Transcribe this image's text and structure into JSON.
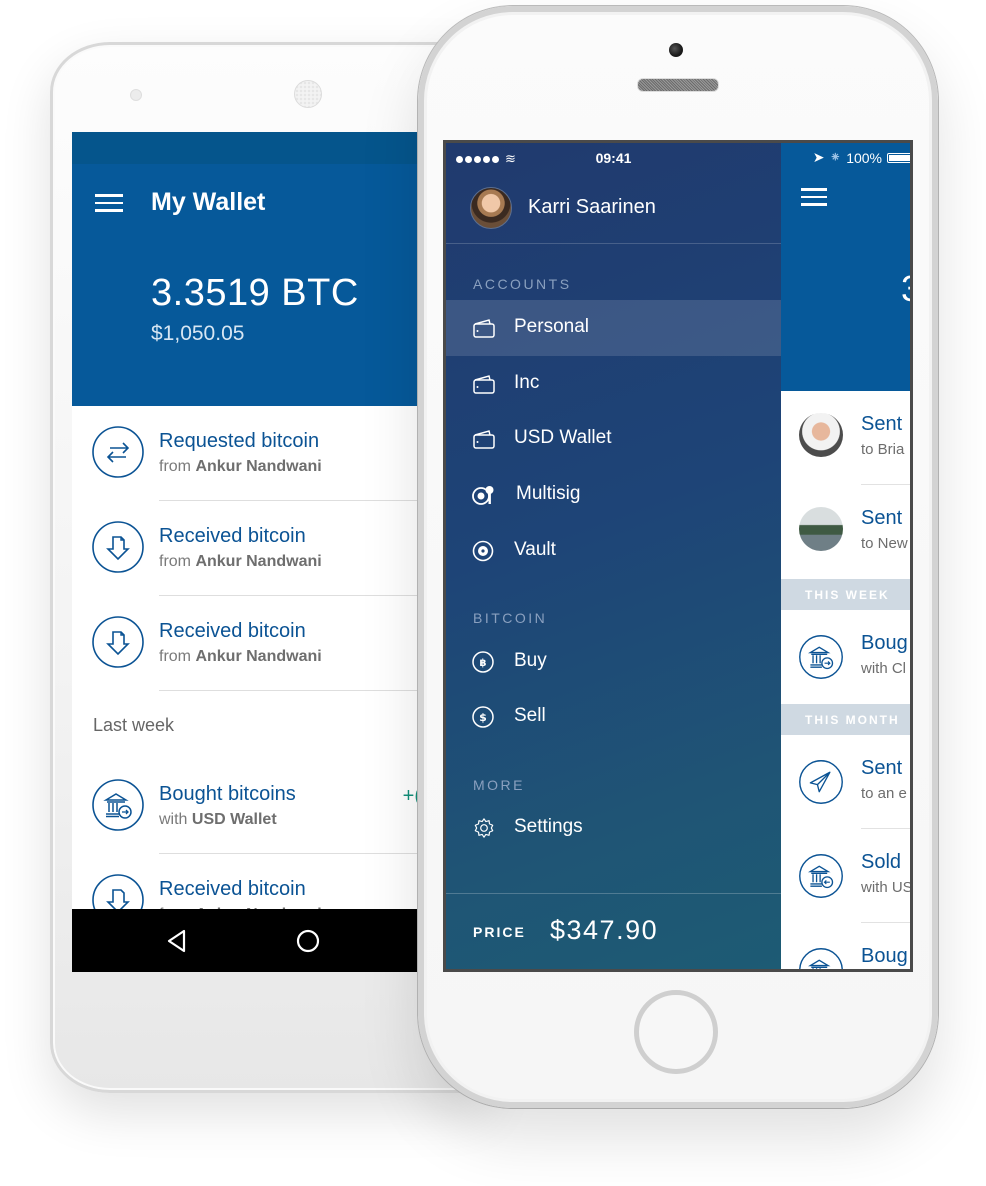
{
  "android": {
    "title": "My Wallet",
    "balance_btc": "3.3519 BTC",
    "balance_usd": "$1,050.05",
    "transactions": [
      {
        "title": "Requested bitcoin",
        "prefix": "from",
        "party": "Ankur Nandwani",
        "icon": "request-arrows-icon"
      },
      {
        "title": "Received bitcoin",
        "prefix": "from",
        "party": "Ankur Nandwani",
        "icon": "receive-download-icon"
      },
      {
        "title": "Received bitcoin",
        "prefix": "from",
        "party": "Ankur Nandwani",
        "icon": "receive-download-icon"
      }
    ],
    "section_last_week": "Last week",
    "last_week_transactions": [
      {
        "title": "Bought bitcoins",
        "prefix": "with",
        "party": "USD Wallet",
        "amount": "+(",
        "icon": "bank-buy-icon"
      },
      {
        "title": "Received bitcoin",
        "prefix": "from",
        "party": "Ankur Nandwani",
        "icon": "receive-download-icon"
      }
    ],
    "colors": {
      "header": "#06599a",
      "accent_text": "#0b5394",
      "positive": "#12907a"
    }
  },
  "iphone": {
    "status": {
      "time": "09:41",
      "battery": "100%"
    },
    "drawer": {
      "user_name": "Karri Saarinen",
      "accounts_heading": "ACCOUNTS",
      "accounts": [
        {
          "label": "Personal",
          "icon": "wallet-icon",
          "active": true
        },
        {
          "label": "Inc",
          "icon": "wallet-icon"
        },
        {
          "label": "USD Wallet",
          "icon": "wallet-icon"
        },
        {
          "label": "Multisig",
          "icon": "multisig-key-icon"
        },
        {
          "label": "Vault",
          "icon": "vault-icon"
        }
      ],
      "bitcoin_heading": "BITCOIN",
      "bitcoin_items": [
        {
          "label": "Buy",
          "icon": "bitcoin-icon"
        },
        {
          "label": "Sell",
          "icon": "dollar-icon"
        }
      ],
      "more_heading": "MORE",
      "more_items": [
        {
          "label": "Settings",
          "icon": "gear-icon"
        }
      ],
      "price_label": "PRICE",
      "price_value": "$347.90"
    },
    "app": {
      "balance_partial": "3",
      "rows_top": [
        {
          "title": "Sent",
          "subtitle": "to Bria"
        },
        {
          "title": "Sent",
          "subtitle": "to New"
        }
      ],
      "section_this_week": "THIS WEEK",
      "rows_week": [
        {
          "title": "Boug",
          "subtitle": "with Cl"
        }
      ],
      "section_this_month": "THIS MONTH",
      "rows_month": [
        {
          "title": "Sent",
          "subtitle": "to an e"
        },
        {
          "title": "Sold",
          "subtitle": "with US"
        },
        {
          "title": "Boug",
          "subtitle": ""
        }
      ]
    }
  }
}
